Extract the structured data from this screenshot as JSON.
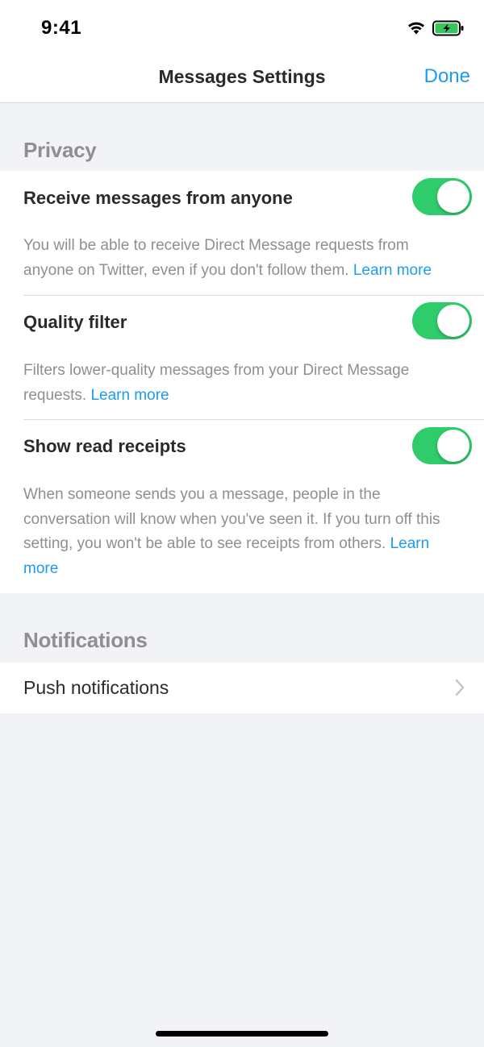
{
  "status_bar": {
    "time": "9:41"
  },
  "nav": {
    "title": "Messages Settings",
    "done_label": "Done"
  },
  "privacy": {
    "header": "Privacy",
    "settings": [
      {
        "title": "Receive messages from anyone",
        "description": "You will be able to receive Direct Message requests from anyone on Twitter, even if you don't follow them.",
        "learn_more": "Learn more",
        "enabled": true
      },
      {
        "title": "Quality filter",
        "description": "Filters lower-quality messages from your Direct Message requests.",
        "learn_more": "Learn more",
        "enabled": true
      },
      {
        "title": "Show read receipts",
        "description": "When someone sends you a message, people in the conversation will know when you've seen it. If you turn off this setting, you won't be able to see receipts from others.",
        "learn_more": "Learn more",
        "enabled": true
      }
    ]
  },
  "notifications": {
    "header": "Notifications",
    "push_label": "Push notifications"
  },
  "colors": {
    "accent": "#1d9bf0",
    "toggle_on": "#2fcc6b",
    "secondary_text": "#8e8e93",
    "background": "#f2f3f7"
  }
}
